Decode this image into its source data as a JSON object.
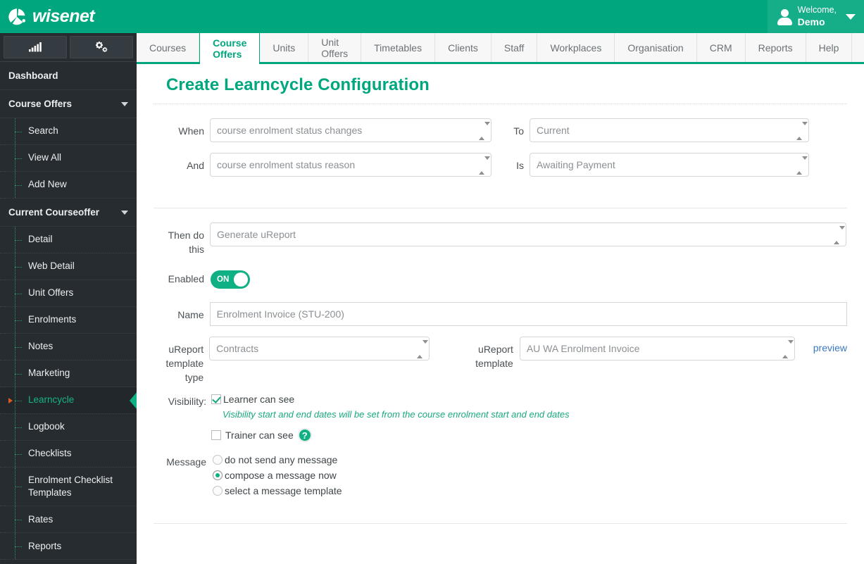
{
  "header": {
    "brand": "wisenet",
    "logo_icon": "wisenet-swoosh-icon",
    "user_greeting": "Welcome,",
    "user_name": "Demo",
    "caret_icon": "chevron-down-icon"
  },
  "sidebar": {
    "tools": [
      {
        "name": "analytics-icon",
        "label": "analytics"
      },
      {
        "name": "settings-gears-icon",
        "label": "settings"
      }
    ],
    "items": [
      {
        "label": "Dashboard",
        "type": "top",
        "chevron": false
      },
      {
        "label": "Course Offers",
        "type": "top",
        "chevron": true
      },
      {
        "label": "Search",
        "type": "child"
      },
      {
        "label": "View All",
        "type": "child"
      },
      {
        "label": "Add New",
        "type": "child"
      },
      {
        "label": "Current Courseoffer",
        "type": "top",
        "chevron": true
      },
      {
        "label": "Detail",
        "type": "child"
      },
      {
        "label": "Web Detail",
        "type": "child"
      },
      {
        "label": "Unit Offers",
        "type": "child"
      },
      {
        "label": "Enrolments",
        "type": "child"
      },
      {
        "label": "Notes",
        "type": "child"
      },
      {
        "label": "Marketing",
        "type": "child"
      },
      {
        "label": "Learncycle",
        "type": "child",
        "active": true
      },
      {
        "label": "Logbook",
        "type": "child"
      },
      {
        "label": "Checklists",
        "type": "child"
      },
      {
        "label": "Enrolment Checklist Templates",
        "type": "child"
      },
      {
        "label": "Rates",
        "type": "child"
      },
      {
        "label": "Reports",
        "type": "child"
      }
    ]
  },
  "tabs": [
    {
      "label": "Courses",
      "active": false
    },
    {
      "label": "Course Offers",
      "active": true
    },
    {
      "label": "Units",
      "active": false
    },
    {
      "label": "Unit Offers",
      "active": false
    },
    {
      "label": "Timetables",
      "active": false
    },
    {
      "label": "Clients",
      "active": false
    },
    {
      "label": "Staff",
      "active": false
    },
    {
      "label": "Workplaces",
      "active": false
    },
    {
      "label": "Organisation",
      "active": false
    },
    {
      "label": "CRM",
      "active": false
    },
    {
      "label": "Reports",
      "active": false
    },
    {
      "label": "Help",
      "active": false
    }
  ],
  "main": {
    "title": "Create Learncycle Configuration",
    "when_label": "When",
    "when_value": "course enrolment status changes",
    "to_label": "To",
    "to_value": "Current",
    "and_label": "And",
    "and_value": "course enrolment status reason",
    "is_label": "Is",
    "is_value": "Awaiting Payment",
    "then_label": "Then do this",
    "then_value": "Generate uReport",
    "enabled_label": "Enabled",
    "enabled_state": "ON",
    "name_label": "Name",
    "name_value": "Enrolment Invoice (STU-200)",
    "name_placeholder": "Name",
    "ureport_type_label": "uReport template type",
    "ureport_type_value": "Contracts",
    "ureport_template_label": "uReport template",
    "ureport_template_value": "AU WA Enrolment Invoice",
    "preview_link": "preview",
    "visibility_label": "Visibility:",
    "visibility_learner": "Learner can see",
    "visibility_learner_checked": true,
    "visibility_note": "Visibility start and end dates will be set from the course enrolment start and end dates",
    "visibility_trainer": "Trainer can see",
    "visibility_trainer_checked": false,
    "help_icon_glyph": "?",
    "message_label": "Message",
    "message_options": [
      {
        "label": "do not send any message",
        "selected": false
      },
      {
        "label": "compose a message now",
        "selected": true
      },
      {
        "label": "select a message template",
        "selected": false
      }
    ]
  },
  "colors": {
    "brand_green": "#00a77e",
    "accent_green": "#0fb083",
    "sidebar_bg": "#272c30",
    "link_blue": "#3a78c0",
    "active_marker_orange": "#e05a1e"
  }
}
